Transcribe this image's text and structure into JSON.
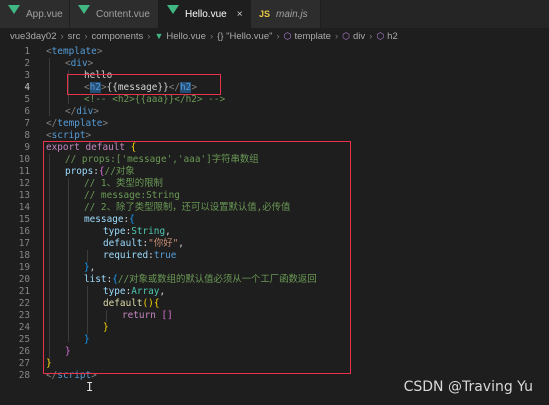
{
  "tabs": [
    {
      "label": "App.vue",
      "icon": "vue-icon",
      "active": false,
      "italic": false
    },
    {
      "label": "Content.vue",
      "icon": "vue-icon",
      "active": false,
      "italic": false
    },
    {
      "label": "Hello.vue",
      "icon": "vue-icon",
      "active": true,
      "italic": false,
      "close": "×"
    },
    {
      "label": "main.js",
      "icon": "js-icon",
      "active": false,
      "italic": true,
      "badge": "JS"
    }
  ],
  "breadcrumb": [
    "vue3day02",
    "src",
    "components",
    "Hello.vue",
    "{} \"Hello.vue\"",
    "template",
    "div",
    "h2"
  ],
  "line_numbers": [
    "1",
    "2",
    "3",
    "4",
    "5",
    "6",
    "7",
    "8",
    "9",
    "10",
    "11",
    "12",
    "13",
    "14",
    "15",
    "16",
    "17",
    "18",
    "19",
    "20",
    "21",
    "22",
    "23",
    "24",
    "25",
    "26",
    "27",
    "28"
  ],
  "current_line": "4",
  "code": {
    "l1": [
      "<",
      "template",
      ">"
    ],
    "l2": [
      "<",
      "div",
      ">"
    ],
    "l3": "hello",
    "l4": [
      "<",
      "h2",
      ">",
      "{{",
      "message",
      "}}",
      "</",
      "h2",
      ">"
    ],
    "l5": "<!-- <h2>{{aaa}}</h2> -->",
    "l6": [
      "</",
      "div",
      ">"
    ],
    "l7": [
      "</",
      "template",
      ">"
    ],
    "l8": [
      "<",
      "script",
      ">"
    ],
    "l9": [
      "export default",
      " {"
    ],
    "l10": "// props:['message','aaa']字符串数组",
    "l11": [
      "props",
      ":",
      "{",
      "//对象"
    ],
    "l12": "// 1、类型的限制",
    "l13": "// message:String",
    "l14": "// 2、除了类型限制，还可以设置默认值,必传值",
    "l15": [
      "message",
      ":",
      "{"
    ],
    "l16": [
      "type",
      ":",
      "String",
      ","
    ],
    "l17": [
      "default",
      ":",
      "\"你好\"",
      ","
    ],
    "l18": [
      "required",
      ":",
      "true"
    ],
    "l19": [
      "}",
      ","
    ],
    "l20": [
      "list",
      ":",
      "{",
      "//对象或数组的默认值必须从一个工厂函数返回"
    ],
    "l21": [
      "type",
      ":",
      "Array",
      ","
    ],
    "l22": [
      "default",
      "()",
      "{"
    ],
    "l23": [
      "return",
      " ",
      "[]"
    ],
    "l24": "}",
    "l25": "}",
    "l26": "}",
    "l27": "}",
    "l28": [
      "</",
      "script",
      ">"
    ]
  },
  "watermark": "CSDN @Traving Yu",
  "colors": {
    "highlight_box": "#e6334a",
    "selection": "#264f78",
    "vue": "#41b883",
    "js": "#e8c547"
  }
}
